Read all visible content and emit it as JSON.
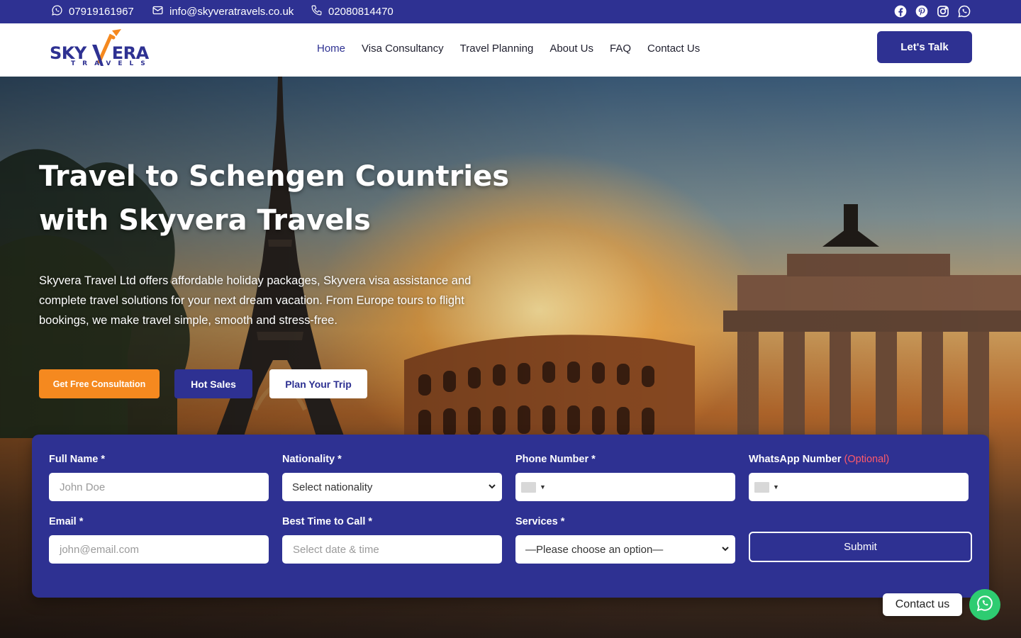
{
  "topbar": {
    "whatsapp": "07919161967",
    "email": "info@skyveratravels.co.uk",
    "phone": "02080814470",
    "social_icons": [
      "facebook-icon",
      "pinterest-icon",
      "instagram-icon",
      "whatsapp-icon"
    ]
  },
  "header": {
    "logo_top": "SKYVERA",
    "logo_bottom": "TRAVELS",
    "nav": [
      "Home",
      "Visa Consultancy",
      "Travel Planning",
      "About Us",
      "FAQ",
      "Contact Us"
    ],
    "active_nav": "Home",
    "cta": "Let's Talk"
  },
  "hero": {
    "title_line1": "Travel to Schengen Countries",
    "title_line2": "with Skyvera Travels",
    "description": "Skyvera Travel Ltd offers affordable holiday packages, Skyvera visa assistance and complete travel solutions for your next dream vacation. From Europe tours to flight bookings, we make travel simple, smooth and stress-free.",
    "btn_consult": "Get Free Consultation",
    "btn_hot": " Hot Sales",
    "btn_plan": "Plan Your Trip"
  },
  "form": {
    "full_name_label": "Full Name *",
    "full_name_placeholder": "John Doe",
    "nationality_label": "Nationality *",
    "nationality_value": "Select nationality",
    "phone_label": "Phone Number *",
    "whatsapp_label": "WhatsApp Number",
    "whatsapp_optional": "(Optional)",
    "email_label": "Email *",
    "email_placeholder": "john@email.com",
    "time_label": "Best Time to Call *",
    "time_placeholder": "Select date & time",
    "services_label": "Services *",
    "services_value": "—Please choose an option—",
    "submit": "Submit"
  },
  "chat": {
    "label": "Contact us"
  },
  "colors": {
    "brand": "#2e3192",
    "accent": "#f5891f",
    "chat": "#2ecc71",
    "optional": "#ff5a6a"
  }
}
